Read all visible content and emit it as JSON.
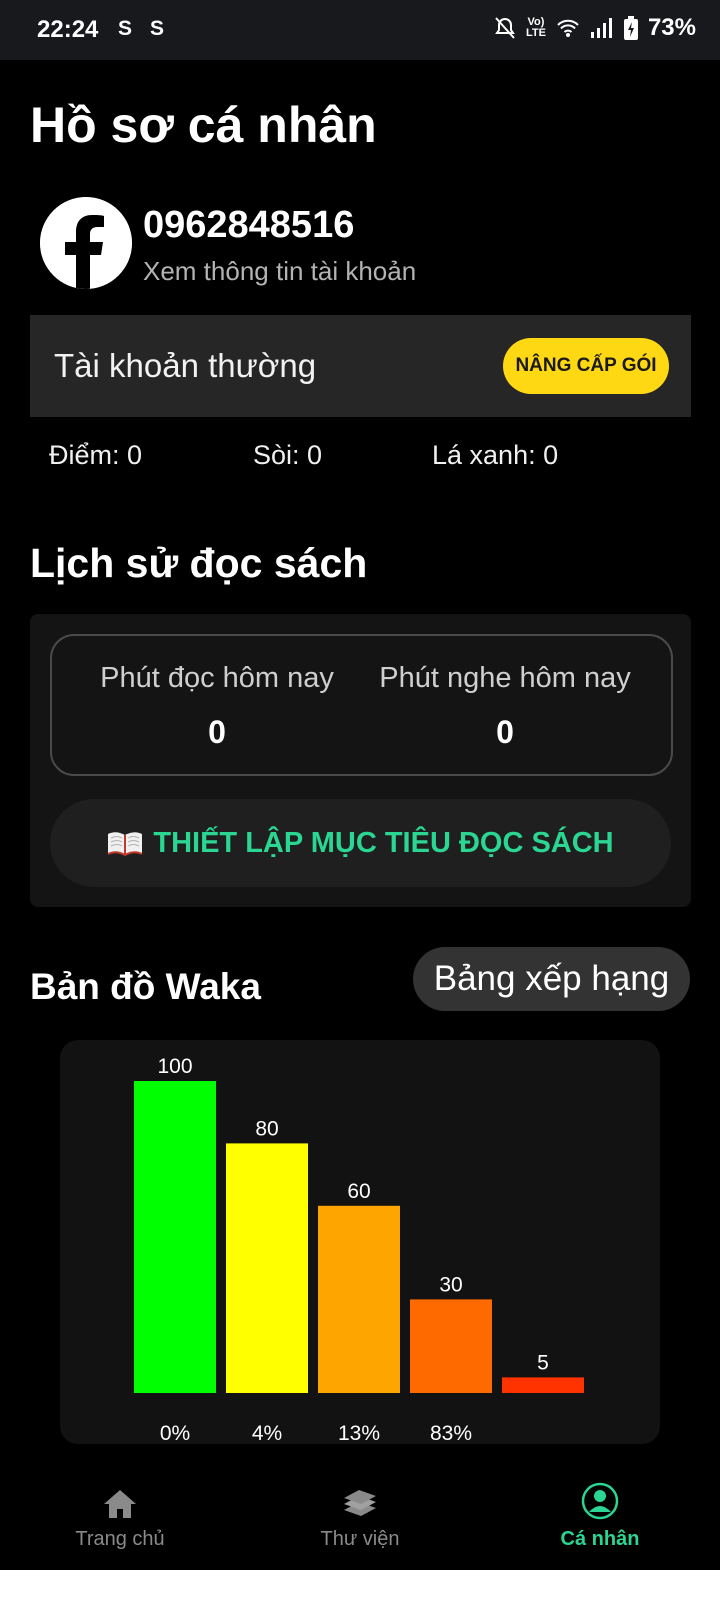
{
  "status_bar": {
    "time": "22:24",
    "notification_icons": [
      "S",
      "S"
    ],
    "system_icons": [
      "bell-muted-icon",
      "volte-icon",
      "wifi-icon",
      "signal-icon",
      "battery-charging-icon"
    ],
    "volte_label": "LTE",
    "battery_percent": "73%"
  },
  "profile": {
    "title": "Hồ sơ cá nhân",
    "avatar_icon": "facebook-logo",
    "account_name": "0962848516",
    "view_account_label": "Xem thông tin tài khoản"
  },
  "membership": {
    "tier_label": "Tài khoản thường",
    "upgrade_label": "NÂNG CẤP GÓI",
    "upgrade_color": "#ffd814"
  },
  "stats": {
    "points": "Điểm: 0",
    "soi": "Sòi: 0",
    "green_leaves": "Lá xanh: 0"
  },
  "reading_history": {
    "title": "Lịch sử đọc sách",
    "read_today_label": "Phút đọc hôm nay",
    "read_today_value": "0",
    "listen_today_label": "Phút nghe hôm nay",
    "listen_today_value": "0",
    "goal_icon": "open-book-icon",
    "goal_label": "THIẾT LẬP MỤC TIÊU ĐỌC SÁCH",
    "accent_color": "#2bd592"
  },
  "waka_map": {
    "title": "Bản đồ Waka",
    "ranking_label": "Bảng xếp hạng"
  },
  "chart_data": {
    "type": "bar",
    "title": "",
    "xlabel": "",
    "ylabel": "",
    "categories": [
      "0%",
      "4%",
      "13%",
      "83%",
      ""
    ],
    "values": [
      100,
      80,
      60,
      30,
      5
    ],
    "colors": [
      "#00ff00",
      "#ffff00",
      "#ffa500",
      "#ff6a00",
      "#ff3300"
    ],
    "ylim": [
      0,
      100
    ],
    "grid": false,
    "legend": "none"
  },
  "bottom_nav": {
    "items": [
      {
        "label": "Trang chủ",
        "icon": "home-icon",
        "active": false
      },
      {
        "label": "Thư viện",
        "icon": "books-icon",
        "active": false
      },
      {
        "label": "Cá nhân",
        "icon": "person-icon",
        "active": true
      }
    ]
  }
}
